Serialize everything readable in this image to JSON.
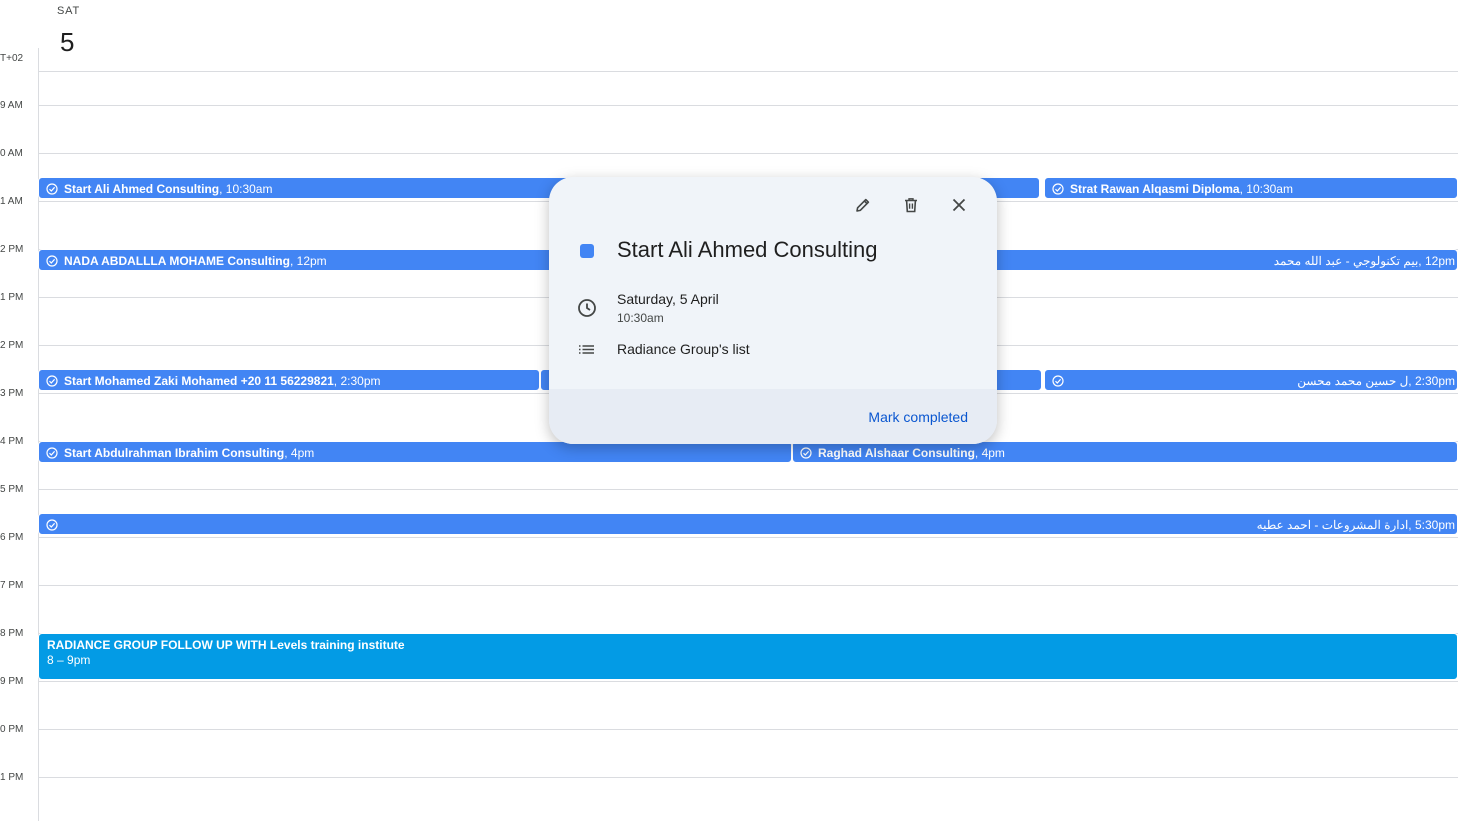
{
  "header": {
    "dow": "SAT",
    "day": "5",
    "timezone": "T+02"
  },
  "hours": [
    "9 AM",
    "0 AM",
    "1 AM",
    "2 PM",
    "1 PM",
    "2 PM",
    "3 PM",
    "4 PM",
    "5 PM",
    "6 PM",
    "7 PM",
    "8 PM",
    "9 PM",
    "0 PM",
    "1 PM"
  ],
  "events": {
    "e1": {
      "title": "Start Ali Ahmed Consulting",
      "time": "10:30am"
    },
    "e2": {
      "title": "Strat Rawan Alqasmi Diploma",
      "time": "10:30am"
    },
    "e3": {
      "title": "NADA ABDALLLA MOHAME Consulting",
      "time": "12pm"
    },
    "e4": {
      "text": "12pm ,بيم تكنولوجي - عبد الله محمد"
    },
    "e5": {
      "title": "Start Mohamed Zaki Mohamed +20 11 56229821",
      "time": "2:30pm"
    },
    "e6": {
      "text": "2:30pm ,ل حسين محمد محسن"
    },
    "e7": {
      "title": "Start Abdulrahman Ibrahim Consulting",
      "time": "4pm"
    },
    "e8": {
      "title": "Raghad Alshaar Consulting",
      "time": "4pm"
    },
    "e9": {
      "text": "5:30pm ,ادارة المشروعات - احمد عطيه"
    },
    "e10": {
      "title": "RADIANCE GROUP FOLLOW UP WITH Levels training institute",
      "time": "8 – 9pm"
    }
  },
  "popover": {
    "title": "Start Ali Ahmed Consulting",
    "date": "Saturday, 5 April",
    "time": "10:30am",
    "list": "Radiance Group's list",
    "action": "Mark completed",
    "color": "#4285f4"
  },
  "colors": {
    "task": "#4285f4",
    "event": "#039be5",
    "accent": "#0b57d0"
  }
}
